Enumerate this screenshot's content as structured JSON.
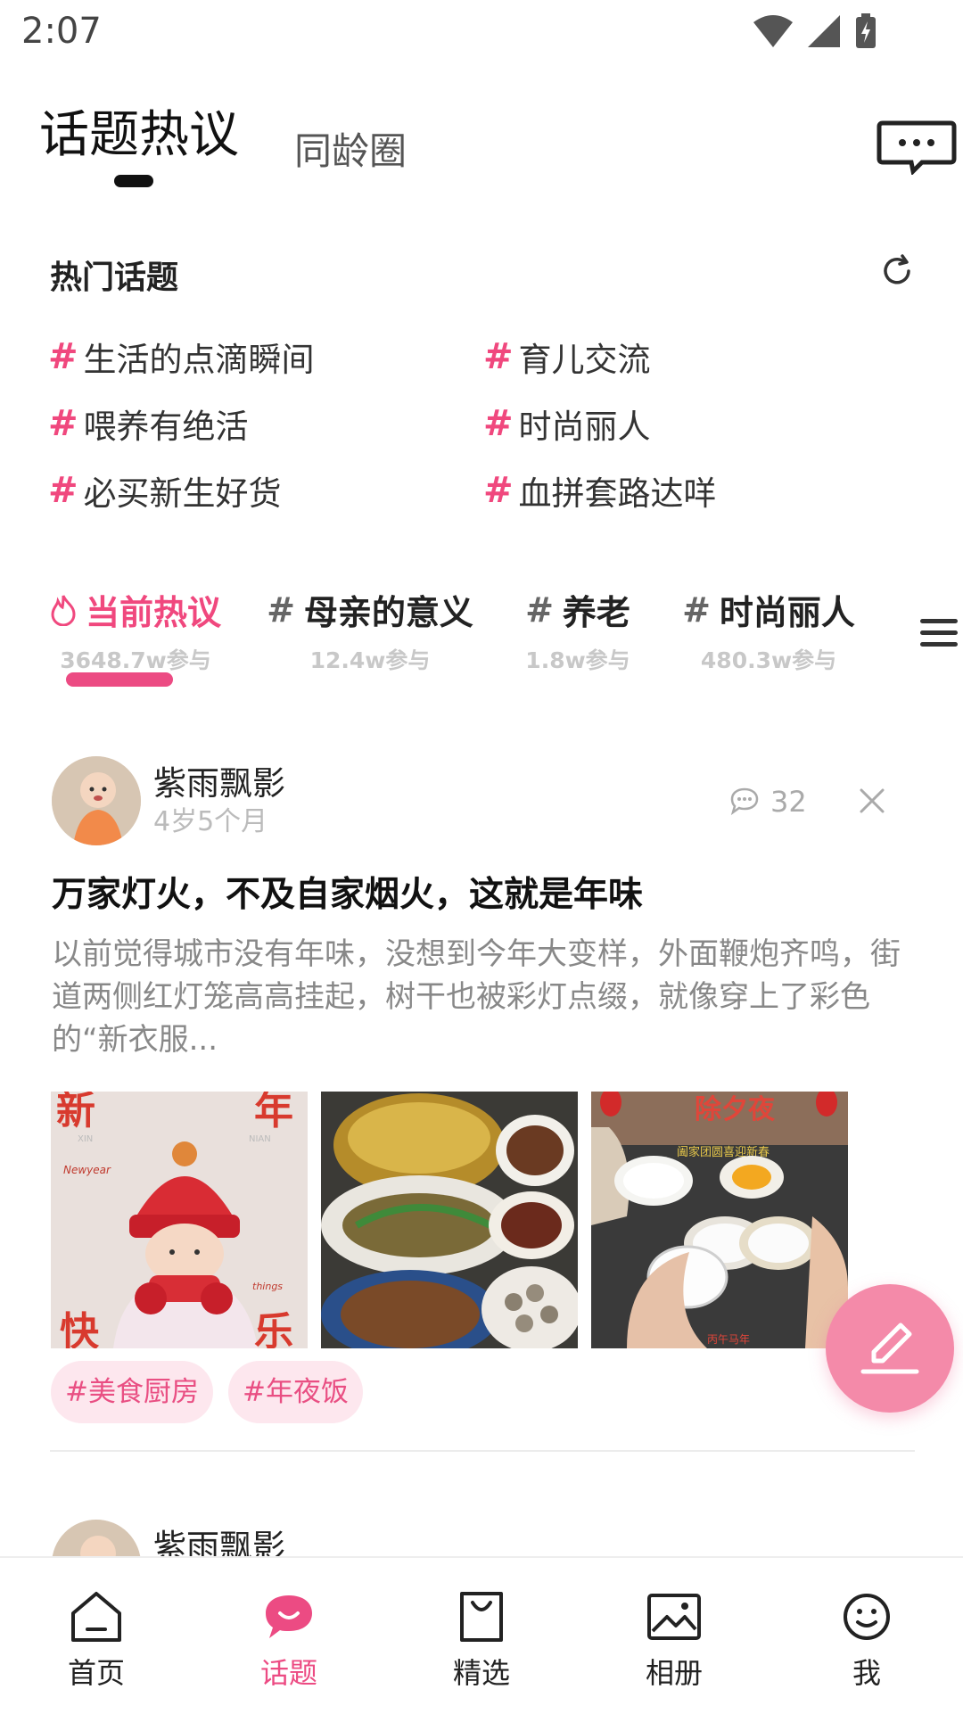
{
  "status_bar": {
    "time": "2:07"
  },
  "header": {
    "active_tab": "话题热议",
    "inactive_tab": "同龄圈"
  },
  "hot_topics": {
    "title": "热门话题",
    "hash": "#",
    "items": [
      "生活的点滴瞬间",
      "育儿交流",
      "喂养有绝活",
      "时尚丽人",
      "必买新生好货",
      "血拼套路达咩"
    ]
  },
  "trending_tabs": [
    {
      "label": "当前热议",
      "count": "3648.7w参与",
      "active": true
    },
    {
      "label": "母亲的意义",
      "count": "12.4w参与"
    },
    {
      "label": "养老",
      "count": "1.8w参与"
    },
    {
      "label": "时尚丽人",
      "count": "480.3w参与"
    }
  ],
  "posts": [
    {
      "author": "紫雨飘影",
      "age": "4岁5个月",
      "comments": "32",
      "title": "万家灯火，不及自家烟火，这就是年味",
      "body": "以前觉得城市没有年味，没想到今年大变样，外面鞭炮齐鸣，街道两侧红灯笼高高挂起，树干也被彩灯点缀，就像穿上了彩色的“新衣服...",
      "tags": [
        "#美食厨房",
        "#年夜饭"
      ],
      "image_texts": [
        "新",
        "年",
        "快",
        "乐",
        "XIN",
        "NIAN",
        "Newyear",
        "things",
        "除夕夜",
        "阖家团圆喜迎新春",
        "丙午马年"
      ]
    },
    {
      "author": "紫雨飘影"
    }
  ],
  "bottom_nav": [
    {
      "label": "首页"
    },
    {
      "label": "话题",
      "active": true
    },
    {
      "label": "精选"
    },
    {
      "label": "相册"
    },
    {
      "label": "我"
    }
  ],
  "colors": {
    "accent": "#ec4b83",
    "hash": "#f0487e",
    "fab": "#f48aa9",
    "tag_bg": "#fde7ee"
  },
  "icons": [
    "message-icon",
    "refresh-icon",
    "flame-icon",
    "menu-icon",
    "comment-icon",
    "close-icon",
    "edit-icon",
    "home-icon",
    "topic-icon",
    "bag-icon",
    "album-icon",
    "profile-icon",
    "wifi-icon",
    "signal-icon",
    "battery-icon"
  ]
}
